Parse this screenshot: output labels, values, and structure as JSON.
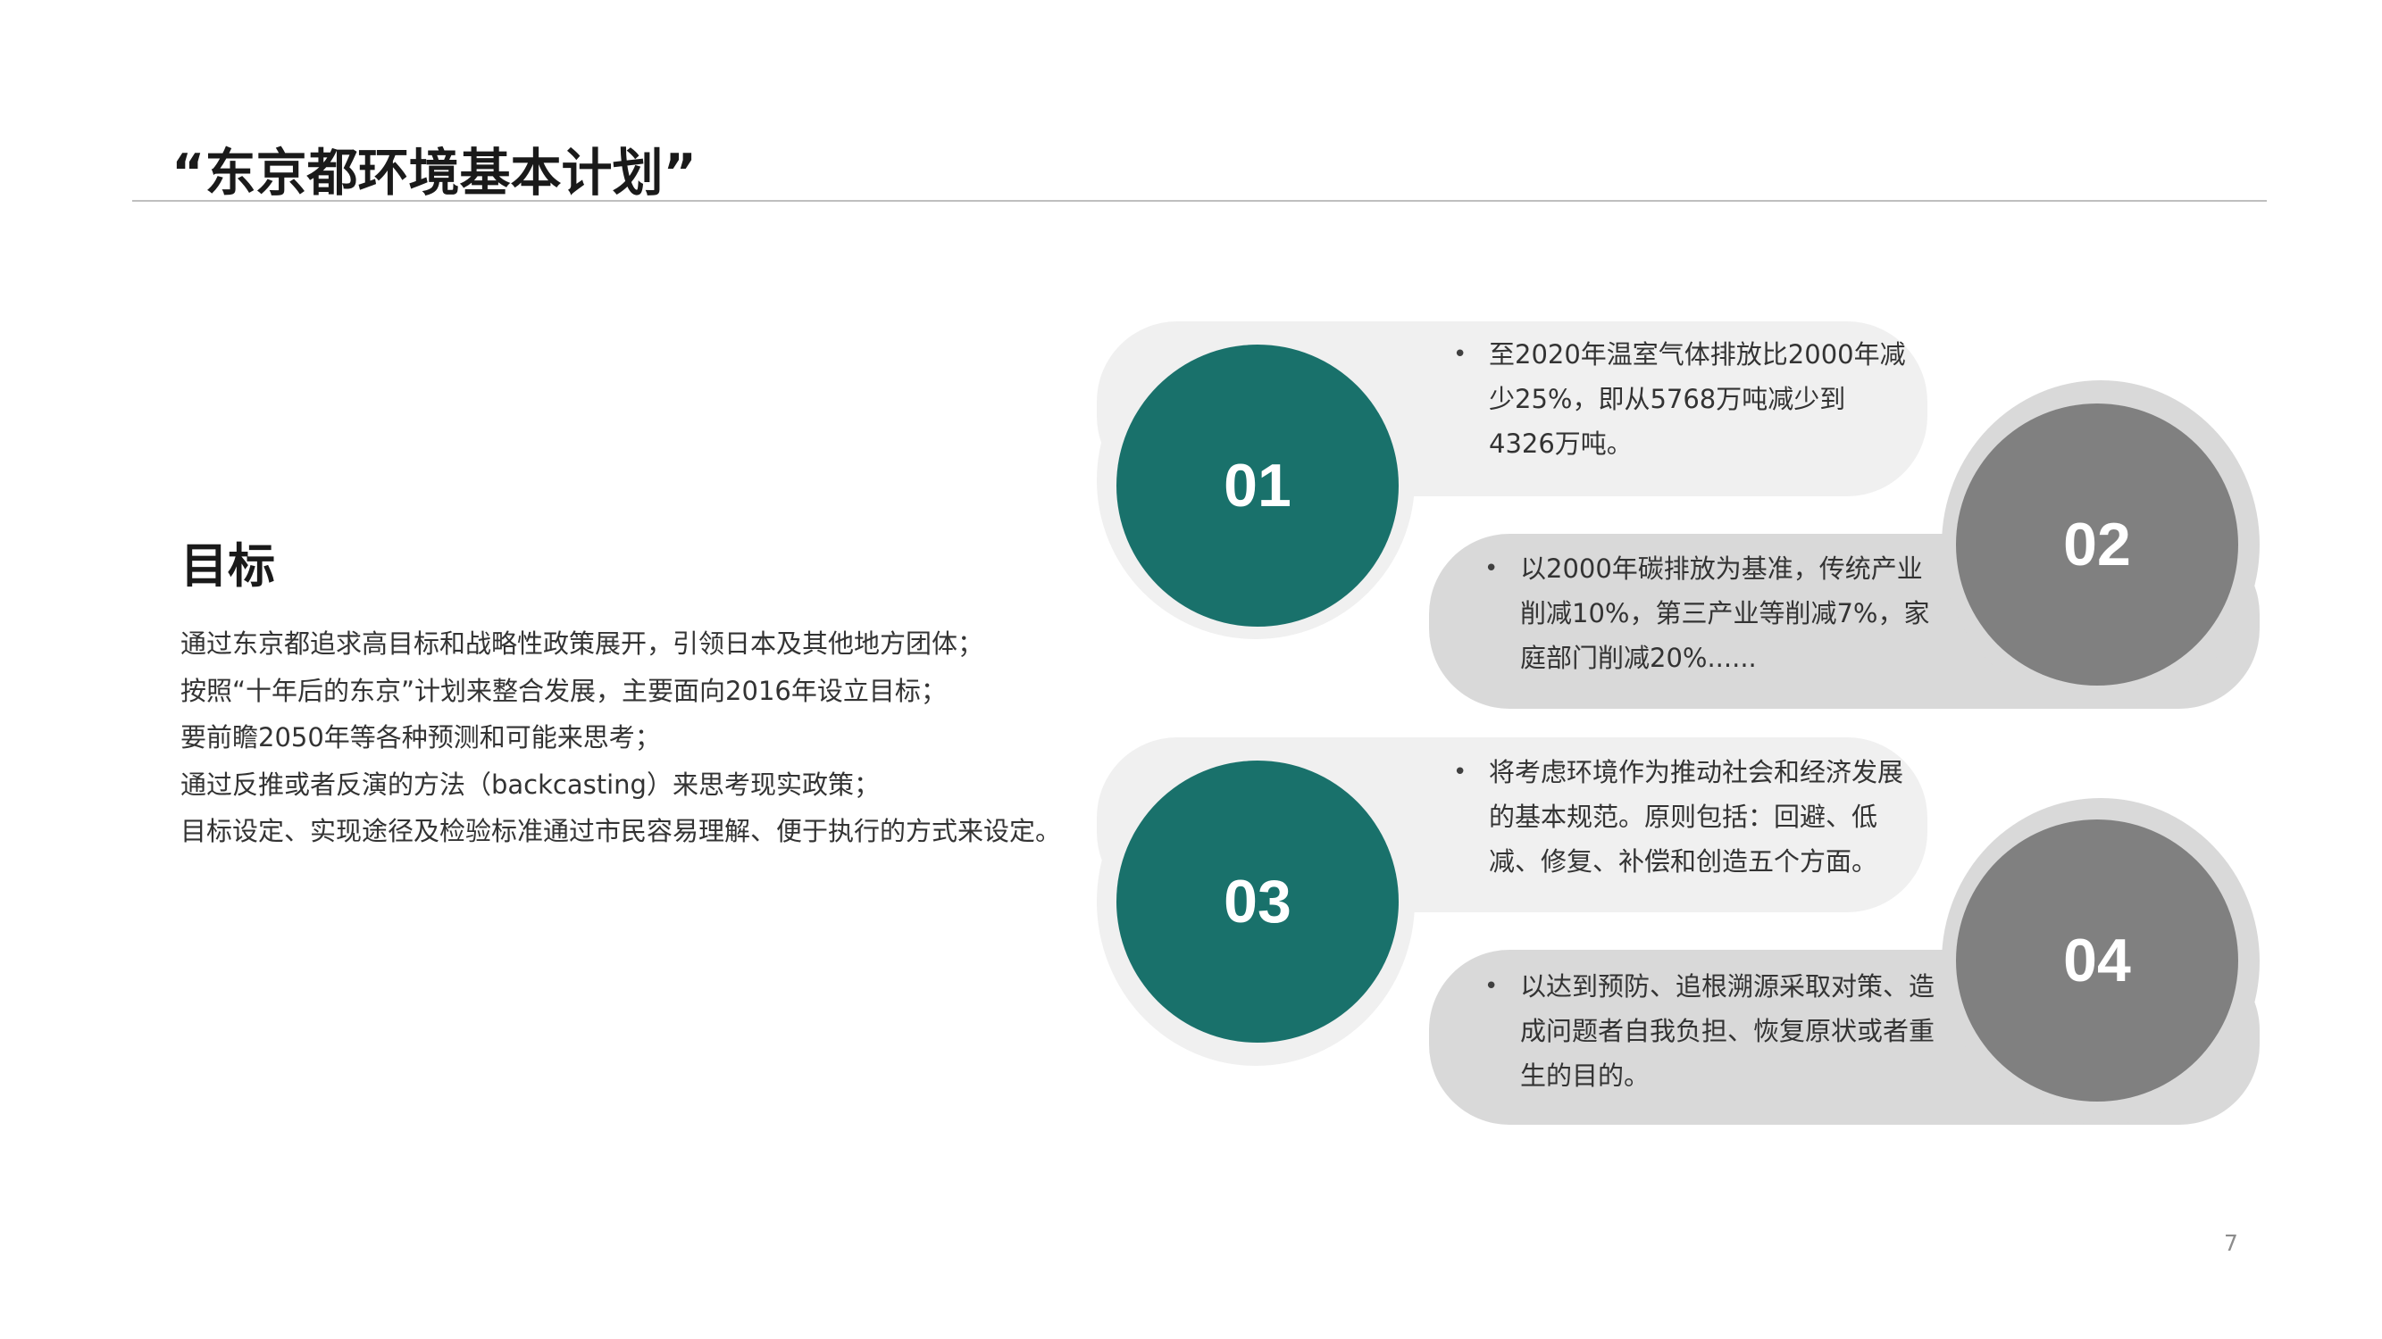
{
  "title": "“东京都环境基本计划”",
  "goal": {
    "heading": "目标",
    "lines": [
      "通过东京都追求高目标和战略性政策展开，引领日本及其他地方团体；",
      "按照“十年后的东京”计划来整合发展，主要面向2016年设立目标；",
      "要前瞻2050年等各种预测和可能来思考；",
      "通过反推或者反演的方法（backcasting）来思考现实政策；",
      "目标设定、实现途径及检验标准通过市民容易理解、便于执行的方式来设定。"
    ]
  },
  "items": [
    {
      "number": "01",
      "bullet": "•",
      "text": "至2020年温室气体排放比2000年减少25%，即从5768万吨减少到4326万吨。",
      "color": "#19716b"
    },
    {
      "number": "02",
      "bullet": "•",
      "text": "以2000年碳排放为基准，传统产业削减10%，第三产业等削减7%，家庭部门削减20%......",
      "color": "#808080"
    },
    {
      "number": "03",
      "bullet": "•",
      "text": "将考虑环境作为推动社会和经济发展的基本规范。原则包括：回避、低减、修复、补偿和创造五个方面。",
      "color": "#19716b"
    },
    {
      "number": "04",
      "bullet": "•",
      "text": "以达到预防、追根溯源采取对策、造成问题者自我负担、恢复原状或者重生的目的。",
      "color": "#808080"
    }
  ],
  "page_number": "7"
}
